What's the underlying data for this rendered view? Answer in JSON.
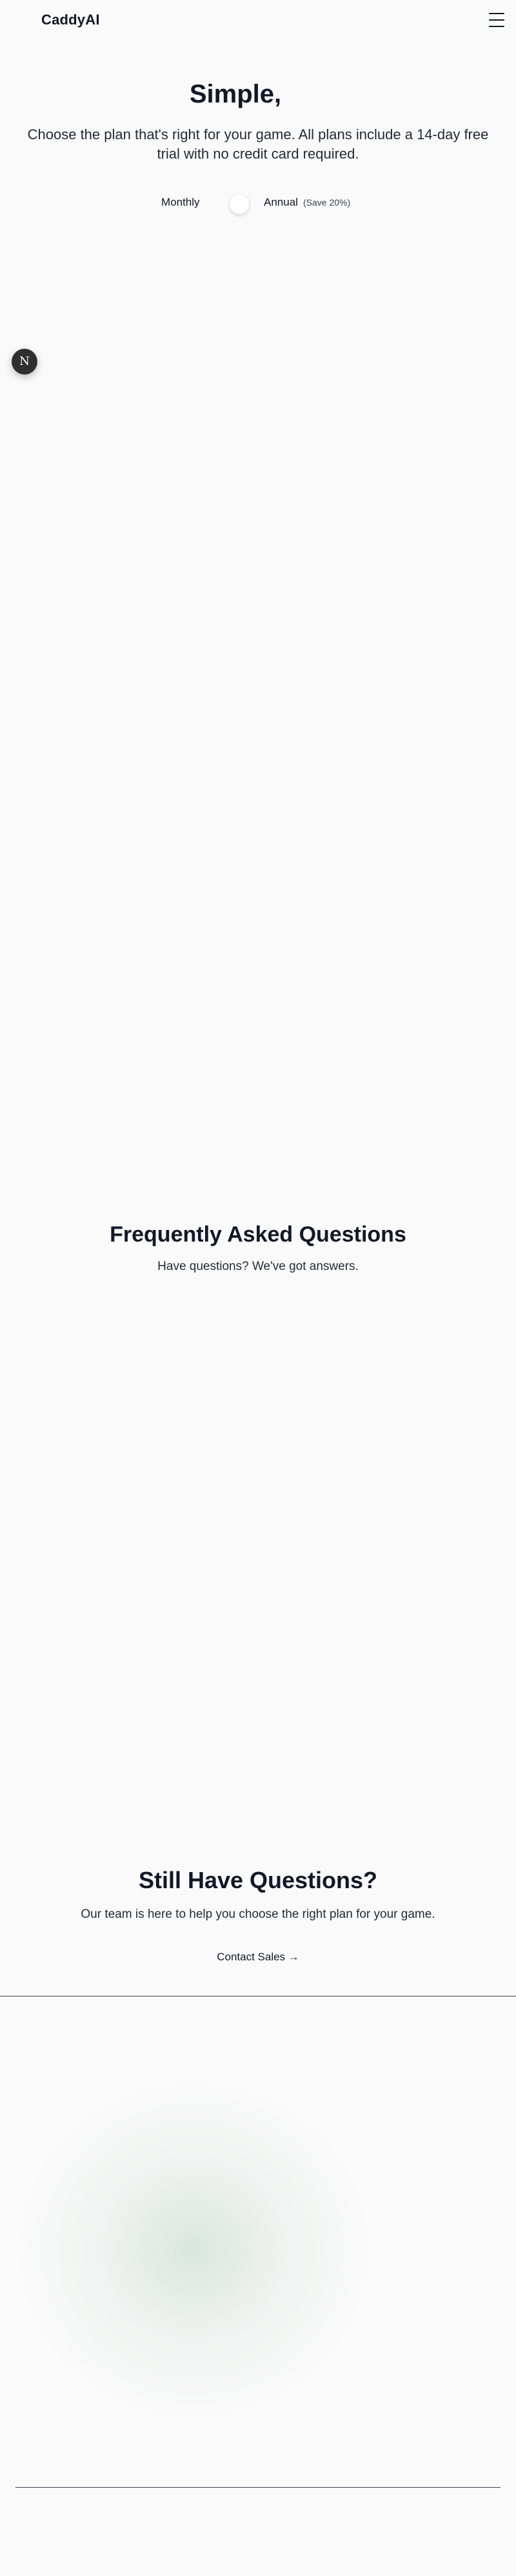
{
  "header": {
    "brand": "CaddyAI",
    "menu_icon": "hamburger-menu-icon"
  },
  "hero": {
    "title": "Simple,",
    "subtitle": "Choose the plan that's right for your game. All plans include a 14-day free trial with no credit card required."
  },
  "billing_toggle": {
    "monthly_label": "Monthly",
    "annual_label": "Annual",
    "annual_note": "(Save 20%)"
  },
  "floating_button": {
    "label": "N",
    "icon": "n-logo-icon"
  },
  "faq": {
    "title": "Frequently Asked Questions",
    "subtitle": "Have questions? We've got answers."
  },
  "cta": {
    "title": "Still Have Questions?",
    "subtitle": "Our team is here to help you choose the right plan for your game.",
    "link_label": "Contact Sales →"
  }
}
